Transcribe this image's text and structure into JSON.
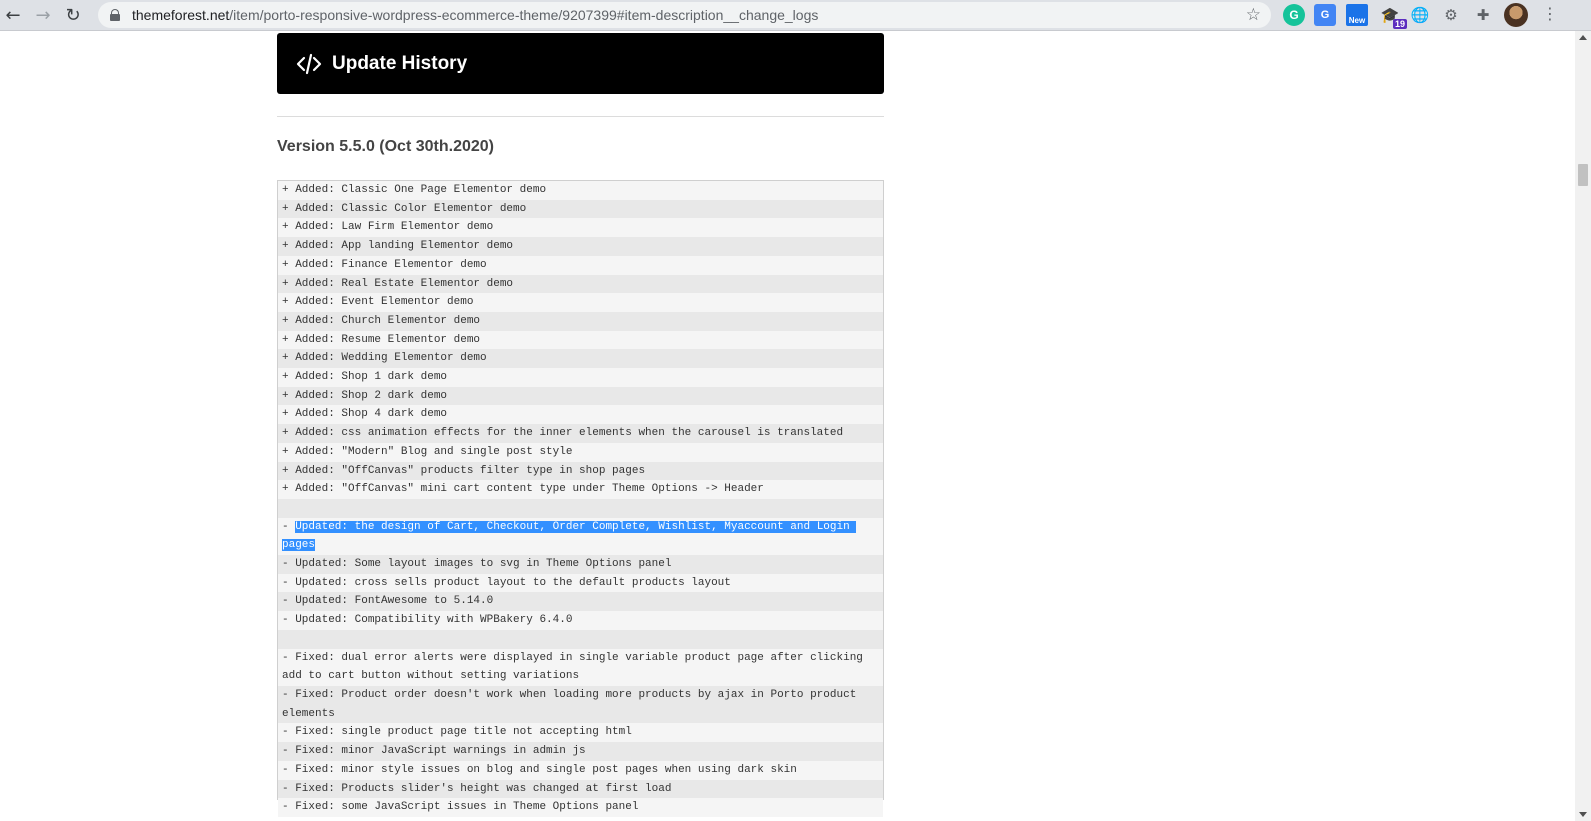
{
  "browser": {
    "url_host": "themeforest.net",
    "url_path": "/item/porto-responsive-wordpress-ecommerce-theme/9207399#item-description__change_logs",
    "back_icon": "←",
    "forward_icon": "→",
    "reload_icon": "↻",
    "star_icon": "☆",
    "extensions": {
      "grammarly": "G",
      "translate": "G",
      "new_badge": "New",
      "grad_icon": "🎓",
      "grad_count": "19",
      "globe": "🌐",
      "film": "⚙",
      "puzzle": "✚",
      "menu": "⋮"
    }
  },
  "page": {
    "header_title": "Update History",
    "version_title": "Version 5.5.0 (Oct 30th.2020)",
    "changelog": [
      {
        "text": "+ Added: Classic One Page Elementor demo"
      },
      {
        "text": "+ Added: Classic Color Elementor demo"
      },
      {
        "text": "+ Added: Law Firm Elementor demo"
      },
      {
        "text": "+ Added: App landing Elementor demo"
      },
      {
        "text": "+ Added: Finance Elementor demo"
      },
      {
        "text": "+ Added: Real Estate Elementor demo"
      },
      {
        "text": "+ Added: Event Elementor demo"
      },
      {
        "text": "+ Added: Church Elementor demo"
      },
      {
        "text": "+ Added: Resume Elementor demo"
      },
      {
        "text": "+ Added: Wedding Elementor demo"
      },
      {
        "text": "+ Added: Shop 1 dark demo"
      },
      {
        "text": "+ Added: Shop 2 dark demo"
      },
      {
        "text": "+ Added: Shop 4 dark demo"
      },
      {
        "text": "+ Added: css animation effects for the inner elements when the carousel is translated"
      },
      {
        "text": "+ Added: \"Modern\" Blog and single post style"
      },
      {
        "text": "+ Added: \"OffCanvas\" products filter type in shop pages"
      },
      {
        "text": "+ Added: \"OffCanvas\" mini cart content type under Theme Options -> Header"
      },
      {
        "text": ""
      },
      {
        "prefix": "- ",
        "text": "Updated: the design of Cart, Checkout, Order Complete, Wishlist, Myaccount and Login pages",
        "selected": true
      },
      {
        "text": "- Updated: Some layout images to svg in Theme Options panel"
      },
      {
        "text": "- Updated: cross sells product layout to the default products layout"
      },
      {
        "text": "- Updated: FontAwesome to 5.14.0"
      },
      {
        "text": "- Updated: Compatibility with WPBakery 6.4.0"
      },
      {
        "text": ""
      },
      {
        "text": "- Fixed: dual error alerts were displayed in single variable product page after clicking add to cart button without setting variations"
      },
      {
        "text": "- Fixed: Product order doesn't work when loading more products by ajax in Porto product elements"
      },
      {
        "text": "- Fixed: single product page title not accepting html"
      },
      {
        "text": "- Fixed: minor JavaScript warnings in admin js"
      },
      {
        "text": "- Fixed: minor style issues on blog and single post pages when using dark skin"
      },
      {
        "text": "- Fixed: Products slider's height was changed at first load"
      },
      {
        "text": "- Fixed: some JavaScript issues in Theme Options panel"
      }
    ]
  }
}
